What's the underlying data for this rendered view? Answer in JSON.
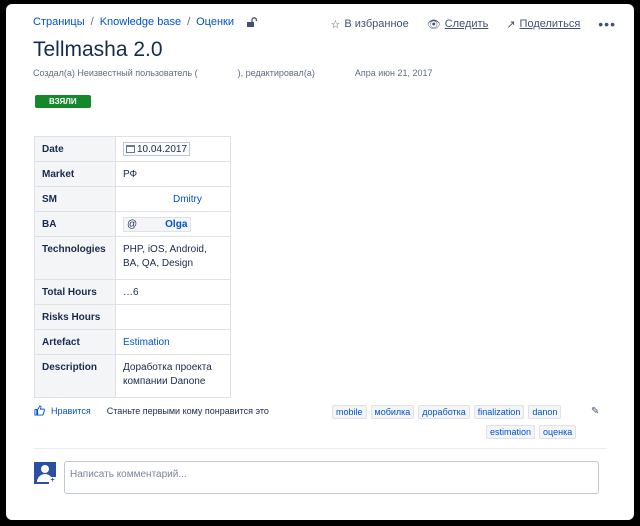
{
  "breadcrumbs": [
    "Страницы",
    "Knowledge base",
    "Оценки"
  ],
  "actions": {
    "favorite": "В избранное",
    "watch": "Следить",
    "share": "Поделиться",
    "more": "•••"
  },
  "page": {
    "title": "Tellmasha 2.0",
    "byline_created": "Создал(а) Неизвестный пользователь (",
    "byline_edited": "), редактировал(а)",
    "byline_date": "Апpа июн 21, 2017",
    "status": "ВЗЯЛИ"
  },
  "table": [
    {
      "key": "Date",
      "value": "10.04.2017"
    },
    {
      "key": "Market",
      "value": "РФ"
    },
    {
      "key": "SM",
      "value": "Dmitry"
    },
    {
      "key": "BA",
      "value": "Olga",
      "prefix": "@"
    },
    {
      "key": "Technologies",
      "value": "PHP, iOS, Android, BA, QA, Design"
    },
    {
      "key": "Total Hours",
      "value": "…6"
    },
    {
      "key": "Risks Hours",
      "value": ""
    },
    {
      "key": "Artefact",
      "value": "Estimation"
    },
    {
      "key": "Description",
      "value": "Доработка проекта компании Danone"
    }
  ],
  "likes": {
    "button": "Нравится",
    "text": "Станьте первыми кому понравится это"
  },
  "labels": [
    "mobile",
    "мобилка",
    "доработка",
    "finalization",
    "danon",
    "estimation",
    "оценка"
  ],
  "comment": {
    "placeholder": "Написать комментарий..."
  },
  "colors": {
    "link": "#0052cc",
    "status_bg": "#14892c",
    "avatar_bg": "#2b4fa3"
  }
}
